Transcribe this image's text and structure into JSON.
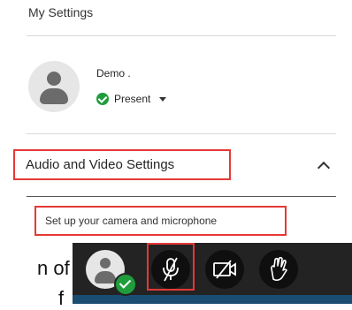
{
  "panel": {
    "title": "My Settings"
  },
  "user": {
    "name": "Demo .",
    "status": "Present"
  },
  "audio_video": {
    "section_title": "Audio and Video Settings",
    "setup_link": "Set up your camera and microphone"
  },
  "background": {
    "partial_line1": "n of",
    "partial_line2": "f"
  },
  "toolbar": {
    "avatar_badge": "present",
    "buttons": [
      "microphone-muted",
      "camera-off",
      "raise-hand"
    ]
  },
  "colors": {
    "highlight": "#e53935",
    "present_green": "#1f9d3c",
    "toolbar_bg": "#232323",
    "toolbar_accent": "#1b4d72"
  }
}
